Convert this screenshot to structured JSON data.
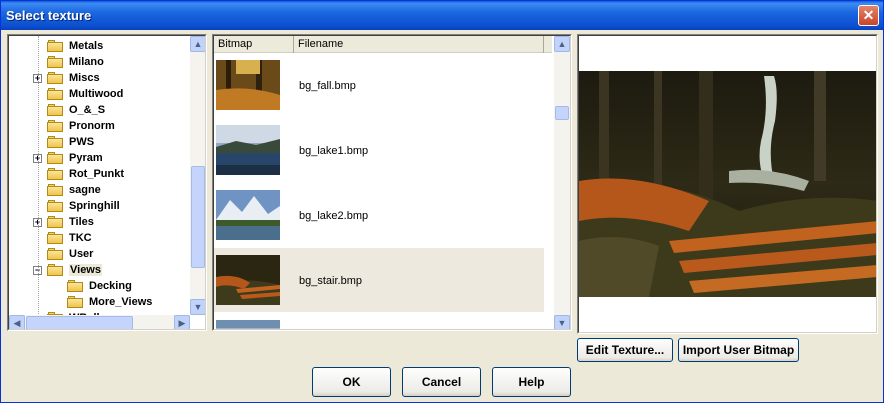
{
  "window": {
    "title": "Select texture"
  },
  "tree": {
    "items": [
      {
        "label": "Metals",
        "expandable": false,
        "indent": 0
      },
      {
        "label": "Milano",
        "expandable": false,
        "indent": 0
      },
      {
        "label": "Miscs",
        "expandable": true,
        "indent": 0
      },
      {
        "label": "Multiwood",
        "expandable": false,
        "indent": 0
      },
      {
        "label": "O_&_S",
        "expandable": false,
        "indent": 0
      },
      {
        "label": "Pronorm",
        "expandable": false,
        "indent": 0
      },
      {
        "label": "PWS",
        "expandable": false,
        "indent": 0
      },
      {
        "label": "Pyram",
        "expandable": true,
        "indent": 0
      },
      {
        "label": "Rot_Punkt",
        "expandable": false,
        "indent": 0
      },
      {
        "label": "sagne",
        "expandable": false,
        "indent": 0
      },
      {
        "label": "Springhill",
        "expandable": false,
        "indent": 0
      },
      {
        "label": "Tiles",
        "expandable": true,
        "indent": 0
      },
      {
        "label": "TKC",
        "expandable": false,
        "indent": 0
      },
      {
        "label": "User",
        "expandable": false,
        "indent": 0
      },
      {
        "label": "Views",
        "expandable": true,
        "expanded": true,
        "indent": 0,
        "selected": true
      },
      {
        "label": "Decking",
        "expandable": false,
        "indent": 1
      },
      {
        "label": "More_Views",
        "expandable": false,
        "indent": 1
      },
      {
        "label": "WBell",
        "expandable": false,
        "indent": 0
      }
    ]
  },
  "list": {
    "columns": [
      "Bitmap",
      "Filename"
    ],
    "rows": [
      {
        "filename": "bg_fall.bmp",
        "thumb": "fall"
      },
      {
        "filename": "bg_lake1.bmp",
        "thumb": "lake1"
      },
      {
        "filename": "bg_lake2.bmp",
        "thumb": "lake2"
      },
      {
        "filename": "bg_stair.bmp",
        "thumb": "stair",
        "selected": true
      },
      {
        "filename": "",
        "thumb": "partial"
      }
    ]
  },
  "preview": {
    "selected_file": "bg_stair.bmp"
  },
  "buttons": {
    "edit_texture": "Edit Texture...",
    "import_bitmap": "Import User Bitmap",
    "ok": "OK",
    "cancel": "Cancel",
    "help": "Help"
  },
  "colors": {
    "titlebar": "#0b4fcf",
    "dialog_bg": "#ece9d8",
    "selected_row": "#ede9df"
  }
}
